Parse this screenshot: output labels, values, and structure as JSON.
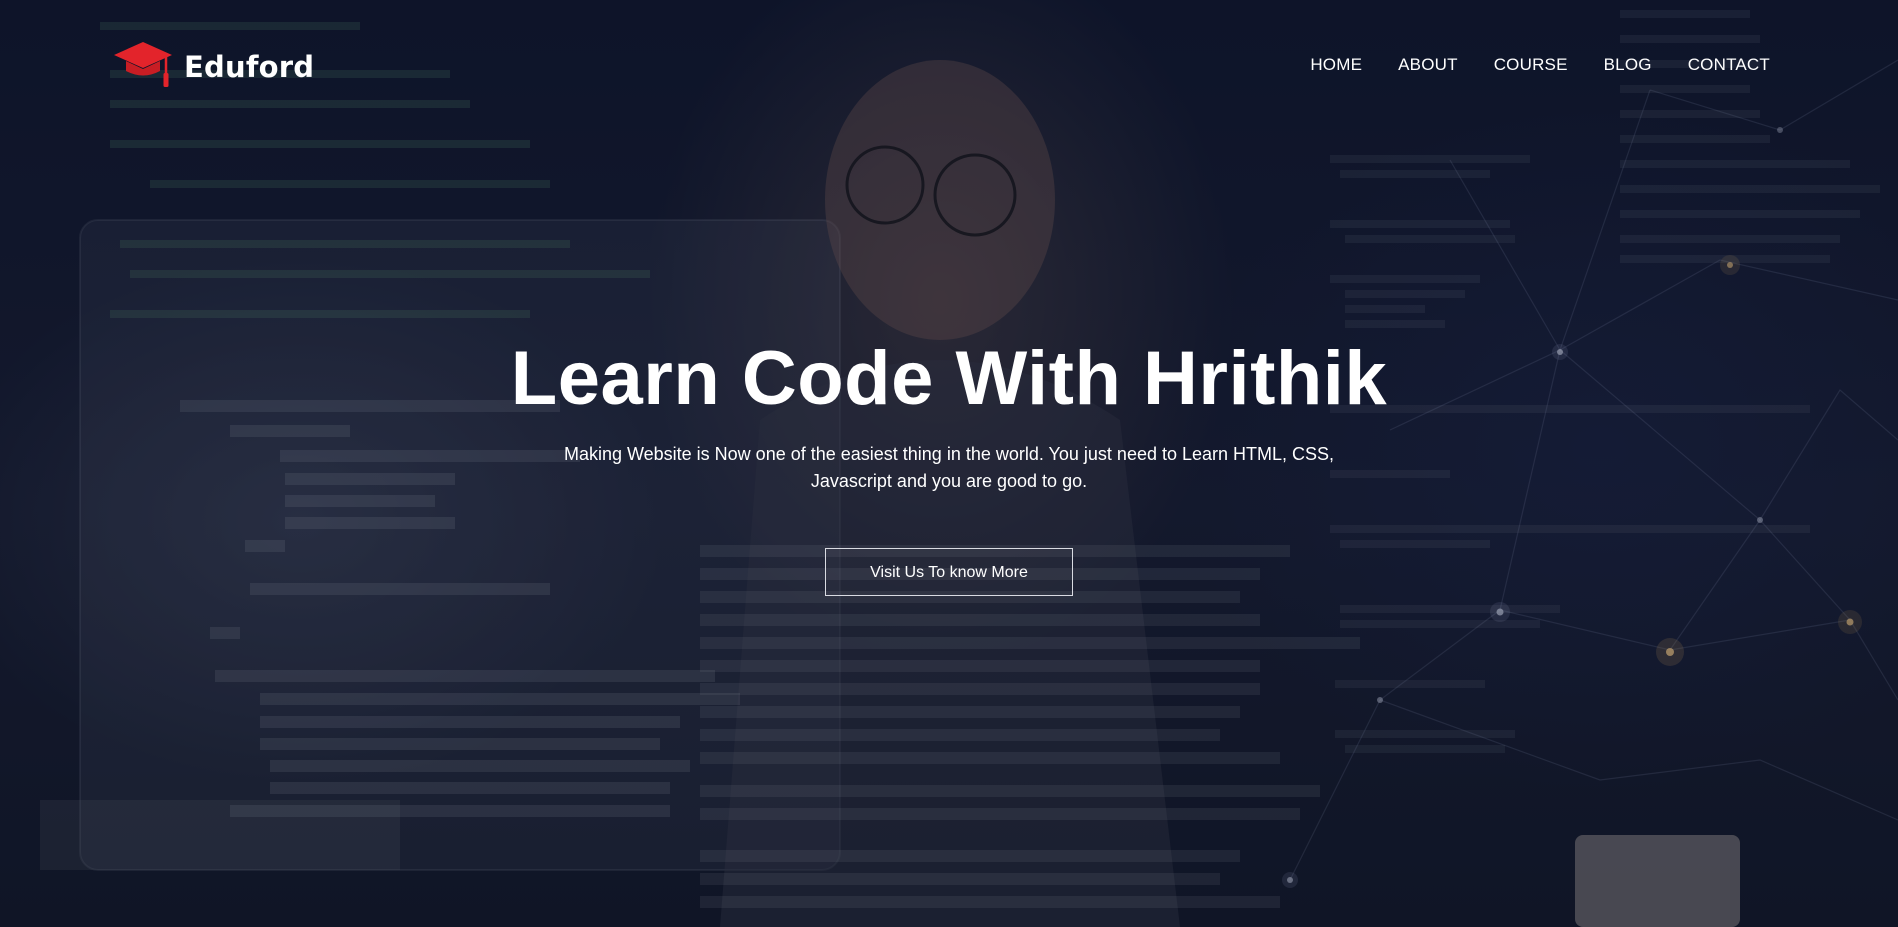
{
  "brand": {
    "name": "Eduford",
    "logo_icon": "graduation-cap-icon",
    "accent_color": "#e3242b"
  },
  "nav": {
    "items": [
      {
        "label": "HOME"
      },
      {
        "label": "ABOUT"
      },
      {
        "label": "COURSE"
      },
      {
        "label": "BLOG"
      },
      {
        "label": "CONTACT"
      }
    ]
  },
  "hero": {
    "title": "Learn Code With Hrithik",
    "subtitle": "Making Website is Now one of the easiest thing in the world. You just need to Learn HTML, CSS, Javascript and you are good to go.",
    "cta_label": "Visit Us To know More"
  }
}
